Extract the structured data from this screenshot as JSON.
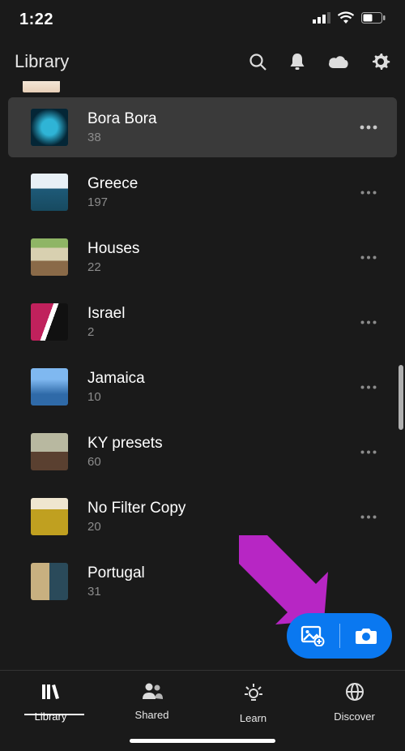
{
  "status": {
    "time": "1:22"
  },
  "header": {
    "title": "Library"
  },
  "albums": [
    {
      "title": "Bora Bora",
      "count": "38",
      "selected": true
    },
    {
      "title": "Greece",
      "count": "197",
      "selected": false
    },
    {
      "title": "Houses",
      "count": "22",
      "selected": false
    },
    {
      "title": "Israel",
      "count": "2",
      "selected": false
    },
    {
      "title": "Jamaica",
      "count": "10",
      "selected": false
    },
    {
      "title": "KY presets",
      "count": "60",
      "selected": false
    },
    {
      "title": "No Filter Copy",
      "count": "20",
      "selected": false
    },
    {
      "title": "Portugal",
      "count": "31",
      "selected": false
    }
  ],
  "tabs": [
    {
      "label": "Library",
      "active": true
    },
    {
      "label": "Shared",
      "active": false
    },
    {
      "label": "Learn",
      "active": false
    },
    {
      "label": "Discover",
      "active": false
    }
  ],
  "colors": {
    "accent": "#0a78f0",
    "annotation": "#b726c4"
  }
}
